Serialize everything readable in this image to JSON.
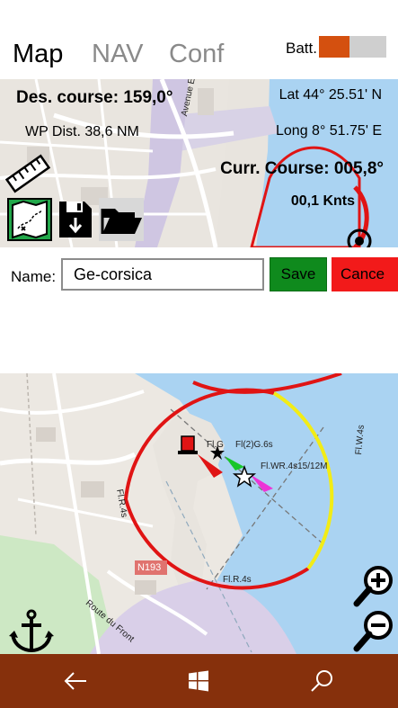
{
  "tabs": {
    "map": "Map",
    "nav": "NAV",
    "conf": "Conf"
  },
  "battery": {
    "label": "Batt.",
    "level": 0.45,
    "fill_color": "#d4500f",
    "empty_color": "#cfcfcf"
  },
  "nav_info": {
    "des_course": "Des. course: 159,0°",
    "wp_dist": "WP Dist. 38,6 NM",
    "lat": "Lat 44° 25.51' N",
    "long": "Long 8° 51.75' E",
    "curr_course": "Curr. Course: 005,8°",
    "speed": "00,1 Knts"
  },
  "map_top": {
    "street_label": "Avenue Emile"
  },
  "toolbar_icons": [
    "ruler-icon",
    "map-icon",
    "save-download-icon",
    "folder-open-icon"
  ],
  "route_form": {
    "name_label": "Name:",
    "name_value": "Ge-corsica",
    "save_label": "Save",
    "cancel_label": "Cance",
    "save_color": "#0f8a1d",
    "cancel_color": "#f21a1a"
  },
  "map_bottom": {
    "labels": {
      "fl_g": "Fl.G",
      "fl2g": "Fl(2)G.6s",
      "flwr": "Fl.WR.4s15/12M",
      "flr_left": "Fl.R.4s",
      "flr_bottom": "Fl.R.4s",
      "flw": "Fl.W.4s",
      "road": "N193",
      "route_du_front": "Route du Front"
    },
    "sector_colors": {
      "red": "#e01414",
      "yellow": "#f2ec16"
    }
  },
  "navbar": {
    "icons": [
      "back-arrow-icon",
      "windows-icon",
      "search-icon"
    ],
    "color": "#86300c"
  }
}
